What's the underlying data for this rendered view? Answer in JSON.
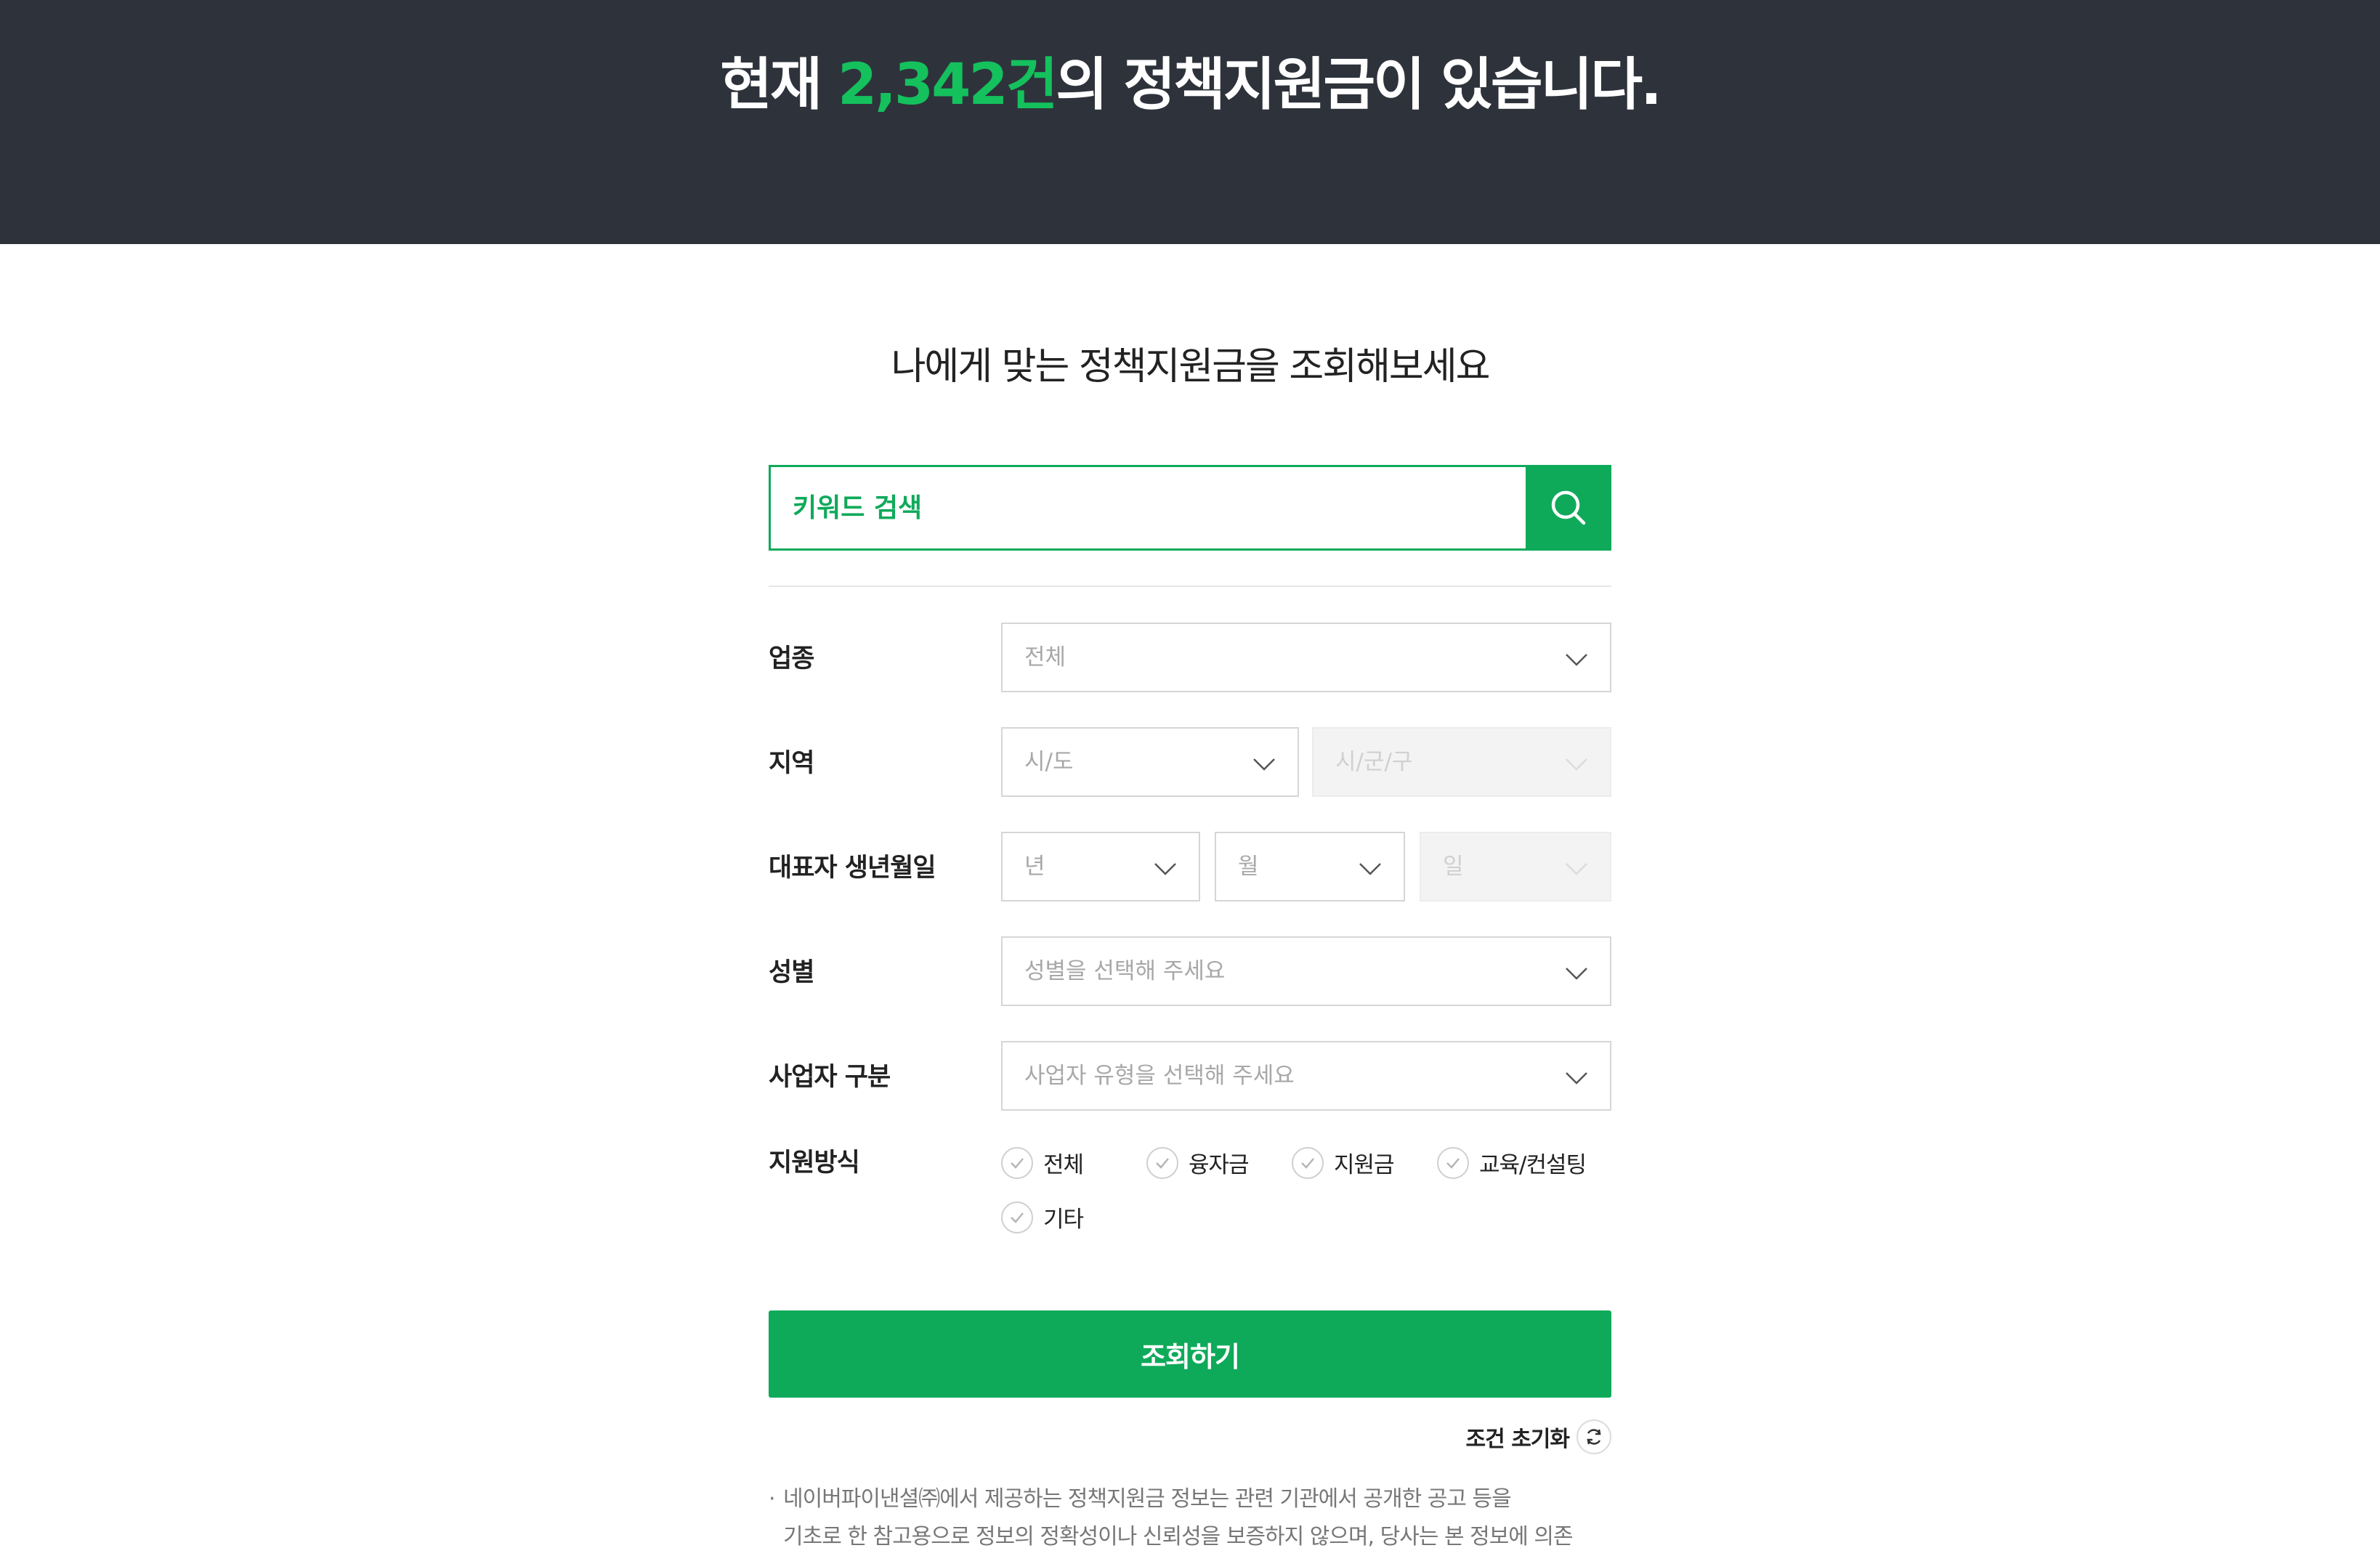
{
  "hero": {
    "prefix": "현재 ",
    "count": "2,342건",
    "suffix": "의 정책지원금이 있습니다."
  },
  "subtitle": "나에게 맞는 정책지원금을 조회해보세요",
  "search": {
    "placeholder": "키워드 검색"
  },
  "filters": {
    "industry": {
      "label": "업종",
      "value": "전체"
    },
    "region": {
      "label": "지역",
      "province": "시/도",
      "district": "시/군/구"
    },
    "birthdate": {
      "label": "대표자 생년월일",
      "year": "년",
      "month": "월",
      "day": "일"
    },
    "gender": {
      "label": "성별",
      "value": "성별을 선택해 주세요"
    },
    "business": {
      "label": "사업자 구분",
      "value": "사업자 유형을 선택해 주세요"
    },
    "support": {
      "label": "지원방식",
      "options": [
        "전체",
        "융자금",
        "지원금",
        "교육/컨설팅",
        "기타"
      ]
    }
  },
  "submit_label": "조회하기",
  "reset_label": "조건 초기화",
  "notice": {
    "bullet": "·",
    "line1": "네이버파이낸셜㈜에서 제공하는 정책지원금 정보는 관련 기관에서 공개한 공고 등을",
    "line2": "기초로 한 참고용으로 정보의 정확성이나 신뢰성을 보증하지 않으며, 당사는 본 정보에 의존"
  },
  "colors": {
    "accent": "#0eaa5a",
    "header_bg": "#2e333b",
    "highlight": "#14c15d"
  }
}
